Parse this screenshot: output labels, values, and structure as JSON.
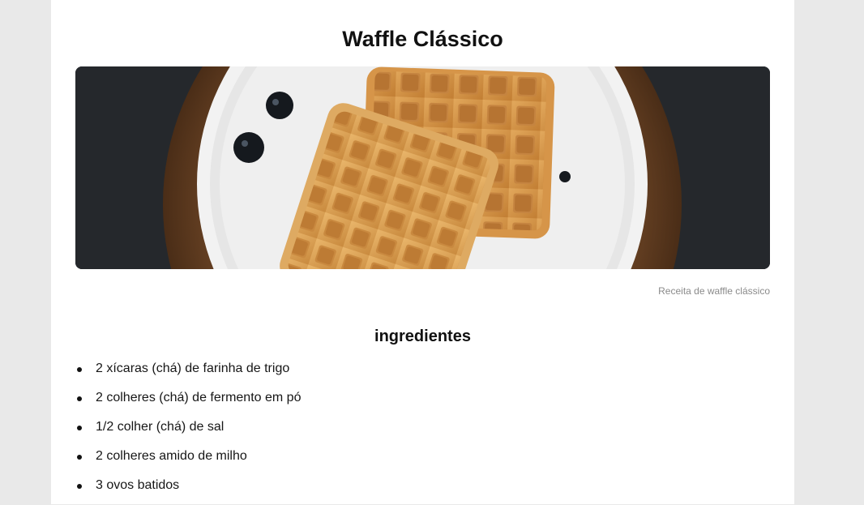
{
  "recipe": {
    "title": "Waffle Clássico",
    "image_caption": "Receita de waffle clássico",
    "ingredients_heading": "ingredientes",
    "ingredients": [
      "2 xícaras (chá) de farinha de trigo",
      "2 colheres (chá) de fermento em pó",
      "1/2 colher (chá) de sal",
      "2 colheres amido de milho",
      "3 ovos batidos"
    ]
  },
  "colors": {
    "page_background": "#e9e9e9",
    "content_background": "#ffffff",
    "text": "#111111",
    "caption": "#8a8a8a"
  }
}
